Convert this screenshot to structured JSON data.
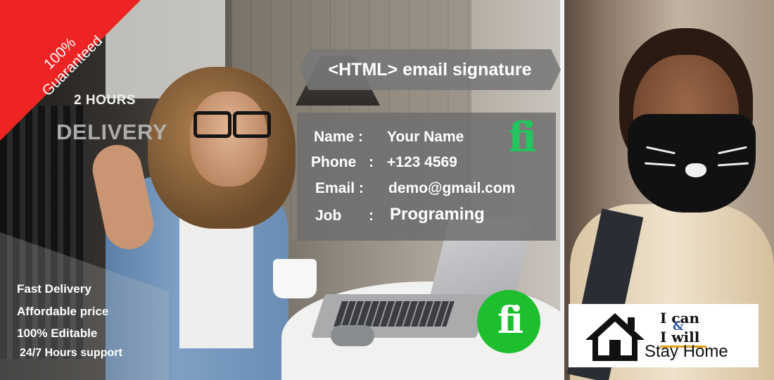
{
  "ribbon": {
    "line1": "100%",
    "line2": "Guaranteed",
    "color": "#ee2424"
  },
  "delivery": {
    "hours": "2 HOURS",
    "word": "DELIVERY"
  },
  "title": "<HTML> email signature",
  "signature": {
    "rows": [
      {
        "label": "Name :",
        "colon": "",
        "value": "Your Name"
      },
      {
        "label": "Phone",
        "colon": ":",
        "value": "+123 4569"
      },
      {
        "label": "Email :",
        "colon": "",
        "value": "demo@gmail.com"
      },
      {
        "label": "Job",
        "colon": ":",
        "value": "Programing"
      }
    ],
    "logo": "fi",
    "logo_color": "#22c55e"
  },
  "features": [
    "Fast Delivery",
    "Affordable price",
    "100% Editable",
    "24/7 Hours support"
  ],
  "brand_logo": {
    "text": "fi",
    "color": "#1dbf2e"
  },
  "stay_home": {
    "line1": "I can",
    "amp": "&",
    "line2": "I will",
    "caption": "Stay Home",
    "icon": "house-icon"
  }
}
